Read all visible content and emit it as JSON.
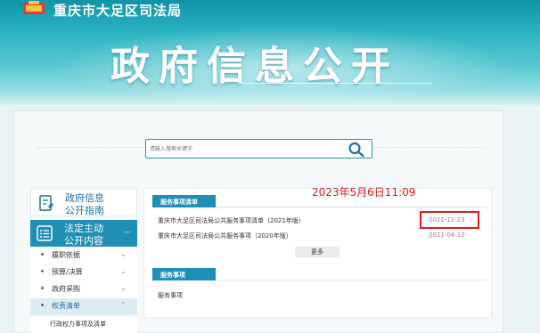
{
  "header": {
    "site_name": "重庆市大足区司法局",
    "banner_title": "政府信息公开"
  },
  "search": {
    "placeholder": "请输入搜索关键字"
  },
  "sidebar": {
    "guide_line1": "政府信息",
    "guide_line2": "公开指南",
    "law_line1": "法定主动",
    "law_line2": "公开内容",
    "law_arrow": "—",
    "items": [
      {
        "label": "履职依据",
        "chevron": "⌄"
      },
      {
        "label": "预算/决算",
        "chevron": "⌄"
      },
      {
        "label": "政府采购",
        "chevron": "⌄"
      },
      {
        "label": "权责清单",
        "chevron": "⌃"
      }
    ],
    "sub_item": "行政权力事项及清单"
  },
  "content": {
    "section1_title": "服务事项清单",
    "rows": [
      {
        "title": "重庆市大足区司法局公共服务事项清单（2021年版）",
        "date": "2021-12-23"
      },
      {
        "title": "重庆市大足区司法局公共服务事项（2020年版）",
        "date": "2021-04-10"
      }
    ],
    "more_label": "更多",
    "section2_title": "服务事项",
    "section2_row": "服务事项"
  },
  "overlay": {
    "timestamp": "2023年5月6日11:09"
  },
  "colors": {
    "accent": "#1f8fb5",
    "annotation": "#e0151b"
  }
}
